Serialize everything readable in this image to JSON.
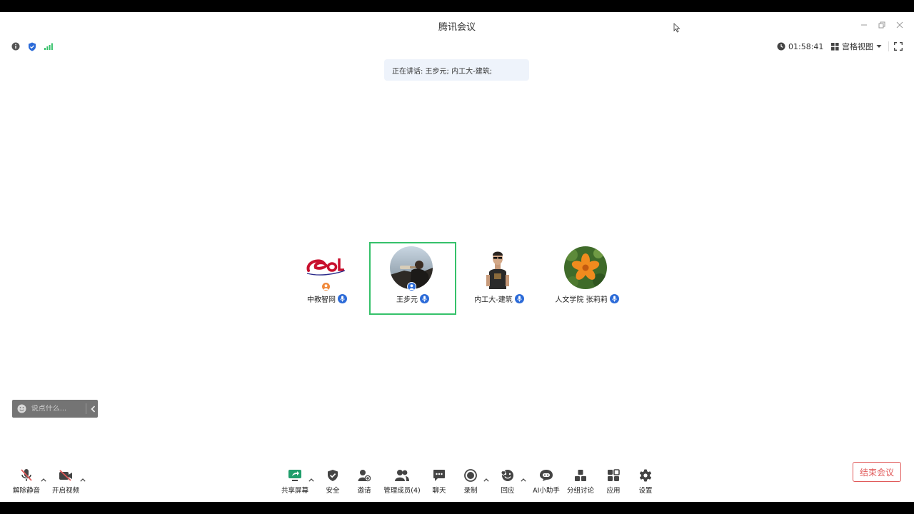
{
  "window": {
    "title": "腾讯会议"
  },
  "infobar": {
    "timer": "01:58:41",
    "view_mode": "宫格视图"
  },
  "speaking": {
    "text": "正在讲话: 王步元; 内工大-建筑;"
  },
  "participants": [
    {
      "name": "中教智网",
      "avatar": "eol-logo-avatar",
      "role_badge_color": "#f08a3c",
      "active": false
    },
    {
      "name": "王步元",
      "avatar": "photo-avatar-person",
      "role_badge_color": "#2c6bd8",
      "active": true
    },
    {
      "name": "内工大-建筑",
      "avatar": "photo-avatar-man",
      "active": false
    },
    {
      "name": "人文学院 张莉莉",
      "avatar": "photo-avatar-flower",
      "active": false
    }
  ],
  "chat": {
    "placeholder": "说点什么..."
  },
  "toolbar": {
    "left": [
      {
        "label": "解除静音",
        "icon": "mic-muted-icon"
      },
      {
        "label": "开启视频",
        "icon": "camera-off-icon"
      }
    ],
    "center": [
      {
        "label": "共享屏幕",
        "icon": "share-screen-icon"
      },
      {
        "label": "安全",
        "icon": "shield-icon"
      },
      {
        "label": "邀请",
        "icon": "invite-icon"
      },
      {
        "label": "管理成员(4)",
        "icon": "members-icon"
      },
      {
        "label": "聊天",
        "icon": "chat-icon"
      },
      {
        "label": "录制",
        "icon": "record-icon"
      },
      {
        "label": "回应",
        "icon": "reaction-icon"
      },
      {
        "label": "AI小助手",
        "icon": "ai-assistant-icon"
      },
      {
        "label": "分组讨论",
        "icon": "breakout-icon"
      },
      {
        "label": "应用",
        "icon": "apps-icon"
      },
      {
        "label": "设置",
        "icon": "settings-icon"
      }
    ],
    "end_meeting": "结束会议"
  },
  "colors": {
    "accent": "#2c6bd8",
    "active_border": "#35c16a",
    "danger": "#e05a5a",
    "signal": "#35c16a"
  }
}
